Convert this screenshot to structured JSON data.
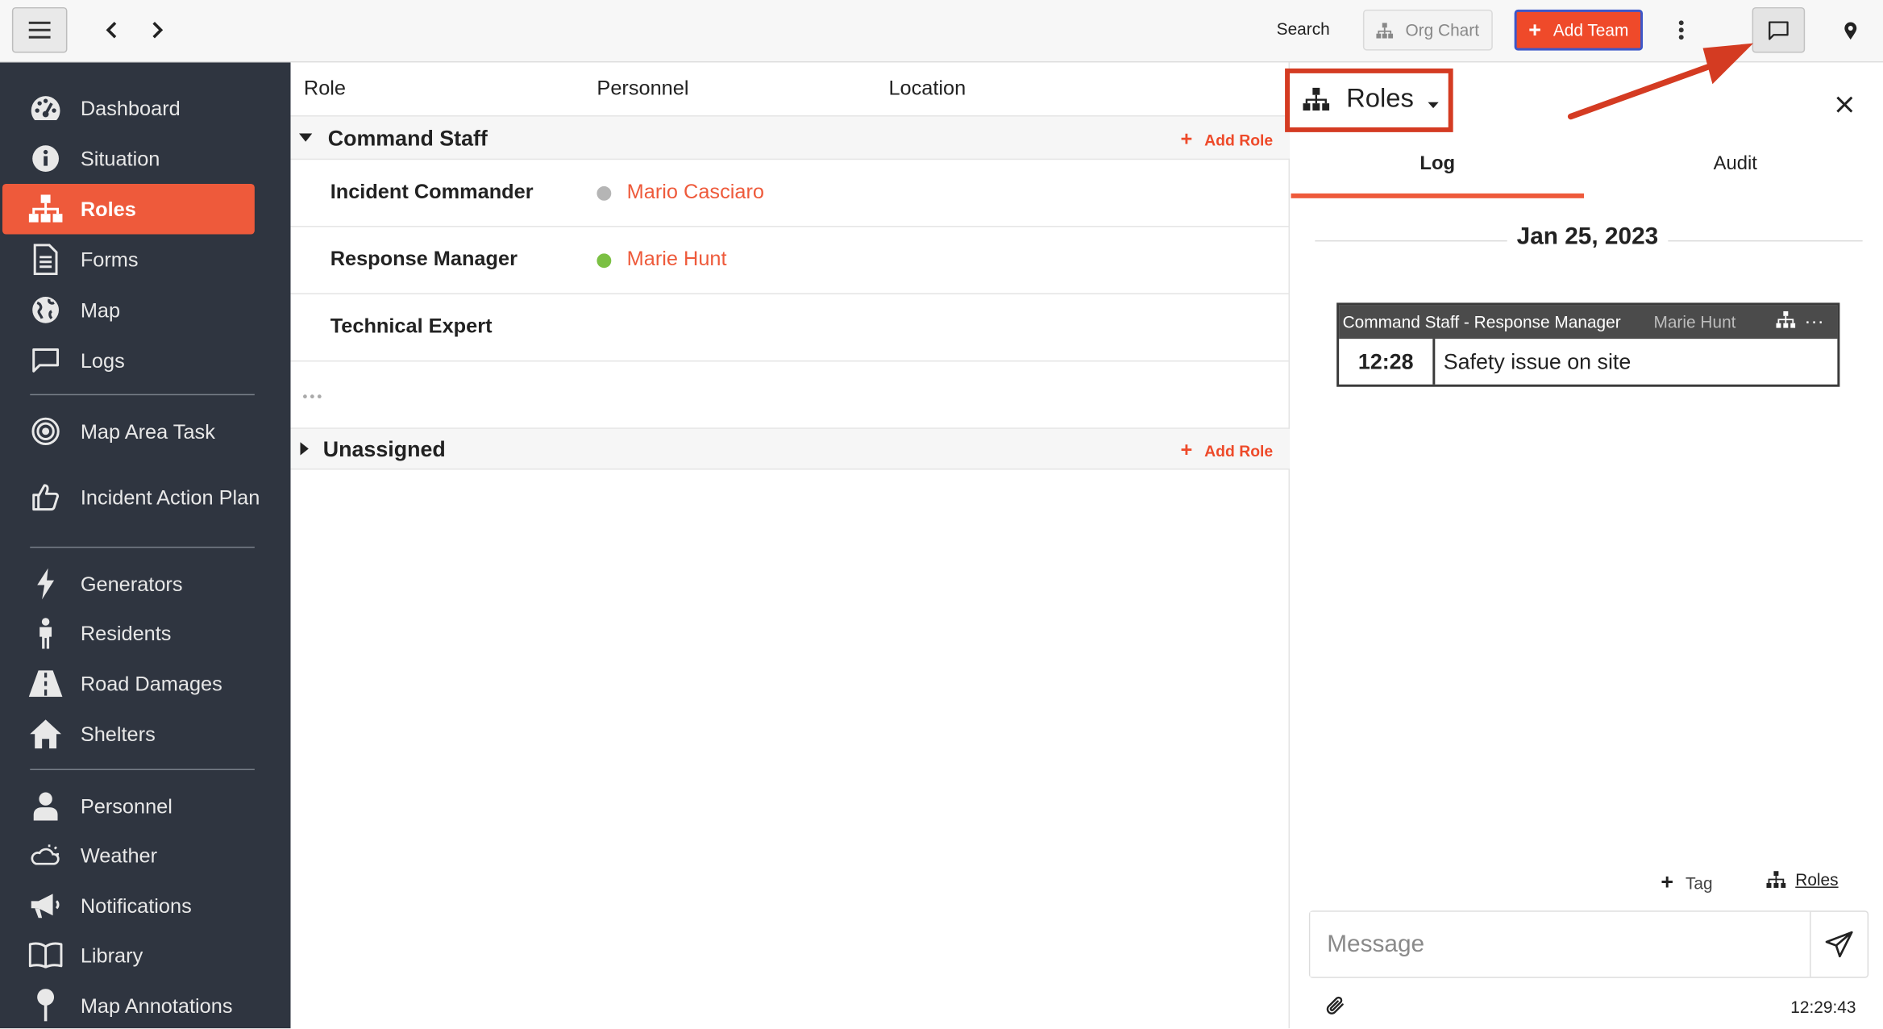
{
  "topbar": {
    "search_label": "Search",
    "org_chart_label": "Org Chart",
    "add_team_label": "Add Team"
  },
  "sidebar": {
    "items": [
      {
        "label": "Dashboard",
        "icon": "dashboard-icon"
      },
      {
        "label": "Situation",
        "icon": "info-icon"
      },
      {
        "label": "Roles",
        "icon": "org-chart-icon",
        "active": true
      },
      {
        "label": "Forms",
        "icon": "document-icon"
      },
      {
        "label": "Map",
        "icon": "globe-icon"
      },
      {
        "label": "Logs",
        "icon": "chat-icon"
      },
      {
        "label": "Map Area Task",
        "icon": "target-icon"
      },
      {
        "label": "Incident Action Plan",
        "icon": "thumbs-up-icon"
      },
      {
        "label": "Generators",
        "icon": "bolt-icon"
      },
      {
        "label": "Residents",
        "icon": "person-icon"
      },
      {
        "label": "Road Damages",
        "icon": "road-icon"
      },
      {
        "label": "Shelters",
        "icon": "home-icon"
      },
      {
        "label": "Personnel",
        "icon": "user-icon"
      },
      {
        "label": "Weather",
        "icon": "weather-icon"
      },
      {
        "label": "Notifications",
        "icon": "megaphone-icon"
      },
      {
        "label": "Library",
        "icon": "book-icon"
      },
      {
        "label": "Map Annotations",
        "icon": "map-pin-icon"
      }
    ]
  },
  "table": {
    "columns": [
      "Role",
      "Personnel",
      "Location"
    ],
    "add_role_label": "Add Role",
    "groups": [
      {
        "title": "Command Staff",
        "expanded": true,
        "roles": [
          {
            "name": "Incident Commander",
            "person": "Mario Casciaro",
            "status_color": "#b5b5b5"
          },
          {
            "name": "Response Manager",
            "person": "Marie Hunt",
            "status_color": "#7bc043"
          },
          {
            "name": "Technical Expert",
            "person": "",
            "status_color": ""
          }
        ]
      },
      {
        "title": "Unassigned",
        "expanded": false,
        "roles": []
      }
    ]
  },
  "panel": {
    "dropdown_label": "Roles",
    "tabs": [
      "Log",
      "Audit"
    ],
    "active_tab": "Log",
    "date": "Jan 25, 2023",
    "log_entry": {
      "header": "Command Staff - Response Manager",
      "author": "Marie Hunt",
      "more": "...",
      "time": "12:28",
      "message": "Safety issue on site"
    },
    "tag_label": "Tag",
    "roles_link_label": "Roles",
    "message_placeholder": "Message",
    "clock": "12:29:43"
  },
  "colors": {
    "accent": "#ee5a3b",
    "sidebar_bg": "#2f3540",
    "annotation_red": "#d43b22"
  }
}
